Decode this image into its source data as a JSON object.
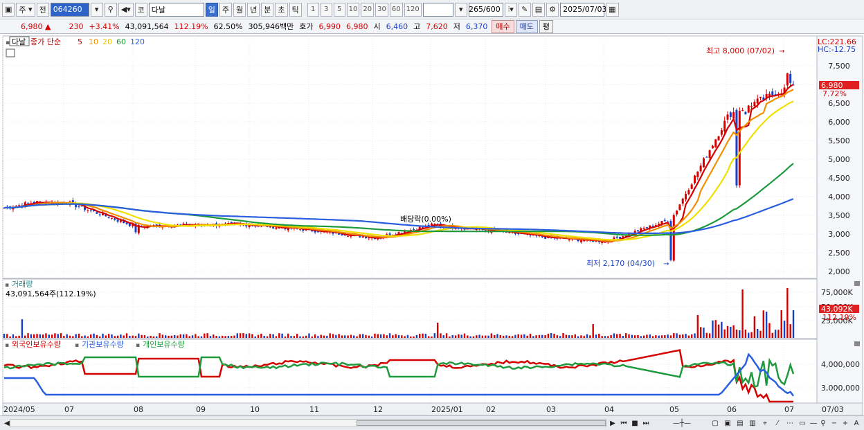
{
  "toolbar": {
    "period_type": "주",
    "prev_label": "전",
    "stock_code": "064260",
    "code_prefix": "코",
    "stock_name": "다날",
    "periods": [
      "일",
      "주",
      "월",
      "년",
      "분",
      "초",
      "틱"
    ],
    "active_period": "일",
    "intervals": [
      "1",
      "3",
      "5",
      "10",
      "20",
      "30",
      "60",
      "120"
    ],
    "count": "265",
    "count_max": "/600",
    "date": "2025/07/03"
  },
  "info": {
    "price": "6,980",
    "arrow": "▲",
    "change": "230",
    "change_pct": "+3.41%",
    "volume": "43,091,564",
    "vol_ratio": "112.19%",
    "turnover": "62.50%",
    "amount": "305,946백만",
    "quote_label": "호가",
    "ask": "6,990",
    "bid": "6,980",
    "open_label": "시",
    "open": "6,460",
    "high_label": "고",
    "high": "7,620",
    "low_label": "저",
    "low": "6,370",
    "buy_label": "매수",
    "sell_label": "매도",
    "flat_label": "평"
  },
  "price_panel": {
    "name_tag": "다날",
    "ma_title": "종가 단순",
    "ma_periods": [
      "5",
      "10",
      "20",
      "60",
      "120"
    ],
    "ma_colors": [
      "#d40000",
      "#f09000",
      "#f0e000",
      "#1e9a3c",
      "#2a5ee0"
    ],
    "lc_label": "LC:221.66",
    "hc_label": "HC:-12.75",
    "y_ticks": [
      "7,500",
      "7,000",
      "6,500",
      "6,000",
      "5,500",
      "5,000",
      "4,500",
      "4,000",
      "3,500",
      "3,000",
      "2,500",
      "2,000"
    ],
    "current_price_tag": "6,980",
    "current_pct_tag": "7.72%",
    "high_annotation": "최고 8,000 (07/02)",
    "low_annotation": "최저 2,170 (04/30)",
    "dividend_annotation": "배당락(0.00%)"
  },
  "volume_panel": {
    "title": "거래량",
    "value": "43,091,564주(112.19%)",
    "y_ticks": [
      "75,000K",
      "50,000K",
      "25,000K"
    ],
    "current_tag": "43,092K",
    "current_pct": "112.19%"
  },
  "holding_panel": {
    "series": [
      "외국인보유수량",
      "기관보유수량",
      "개인보유수량"
    ],
    "colors": [
      "#d40000",
      "#2a5ee0",
      "#1e9a3c"
    ],
    "y_ticks": [
      "4,000,000",
      "3,000,000"
    ]
  },
  "x_axis": {
    "labels": [
      "2024/05",
      "07",
      "08",
      "09",
      "10",
      "11",
      "12",
      "2025/01",
      "02",
      "03",
      "04",
      "05",
      "06",
      "07"
    ],
    "right_label": "07/03"
  },
  "chart_data": {
    "type": "candlestick",
    "x_range": [
      "2024/05",
      "2025/07/03"
    ],
    "ylim": [
      2000,
      8000
    ],
    "approx_close_by_month": [
      {
        "month": "2024/05",
        "close": 3700
      },
      {
        "month": "2024/06",
        "close": 3850
      },
      {
        "month": "2024/07",
        "close": 3850
      },
      {
        "month": "2024/08",
        "close": 3200
      },
      {
        "month": "2024/09",
        "close": 3250
      },
      {
        "month": "2024/10",
        "close": 3250
      },
      {
        "month": "2024/11",
        "close": 3100
      },
      {
        "month": "2024/12",
        "close": 2900
      },
      {
        "month": "2025/01",
        "close": 3250
      },
      {
        "month": "2025/02",
        "close": 3100
      },
      {
        "month": "2025/03",
        "close": 2900
      },
      {
        "month": "2025/04",
        "close": 2800
      },
      {
        "month": "2025/05",
        "close": 3400
      },
      {
        "month": "2025/06",
        "close": 6200
      },
      {
        "month": "2025/07",
        "close": 6980
      }
    ],
    "high": {
      "value": 8000,
      "date": "07/02"
    },
    "low": {
      "value": 2170,
      "date": "04/30"
    }
  }
}
